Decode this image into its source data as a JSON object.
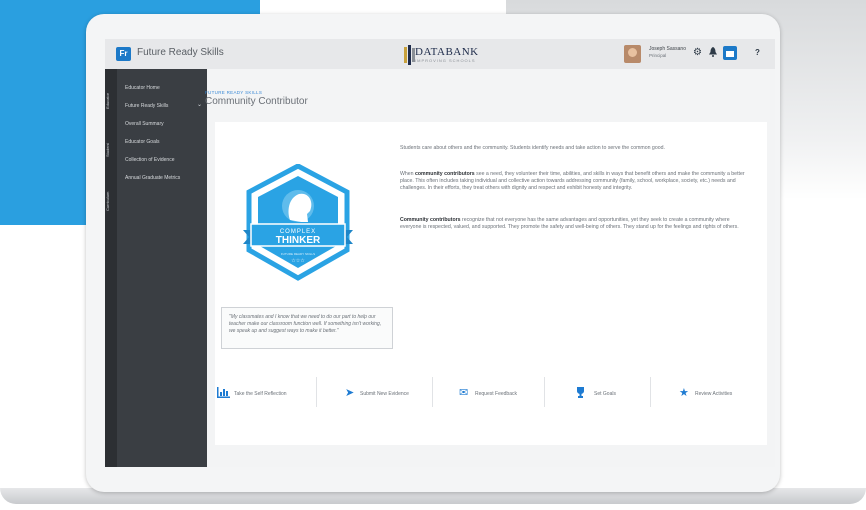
{
  "app": {
    "badge": "Fr",
    "name": "Future Ready Skills",
    "logo_text": "DATABANK",
    "logo_subtext": "IMPROVING SCHOOLS"
  },
  "user": {
    "name": "Joseph Sassano",
    "role": "Principal",
    "org": "Databank"
  },
  "toolbar": {
    "icons": [
      "gear-icon",
      "bell-icon",
      "calendar-icon",
      "help-icon"
    ],
    "glyphs": [
      "⚙",
      "🔔",
      "▣",
      "?"
    ]
  },
  "rail": {
    "tabs": [
      "Educator",
      "Student",
      "Curriculum"
    ]
  },
  "sidebar": {
    "items": [
      {
        "label": "Educator Home"
      },
      {
        "label": "Future Ready Skills"
      },
      {
        "label": "Overall Summary"
      },
      {
        "label": "Educator Goals"
      },
      {
        "label": "Collection of Evidence"
      },
      {
        "label": "Annual Graduate Metrics"
      }
    ]
  },
  "page": {
    "kicker": "FUTURE READY SKILLS",
    "title": "Community Contributor"
  },
  "badge": {
    "line1": "COMPLEX",
    "line2": "THINKER",
    "level": "FUTURE READY SKILLS",
    "stars": "☆☆☆"
  },
  "quote": {
    "text": "\"My classmates and I know that we need to do our part to help our teacher make our classroom function well. If something isn't working, we speak up and suggest ways to make it better.\""
  },
  "description": {
    "p1": "Students care about others and the community. Students identify needs and take action to serve the common good.",
    "p2_lead": "community contributors",
    "p2_pre": "When ",
    "p2_rest": " see a need, they volunteer their time, abilities, and skills in ways that benefit others and make the community a better place. This often includes taking individual and collective action towards addressing community (family, school, workplace, society, etc.) needs and challenges. In their efforts, they treat others with dignity and respect and exhibit honesty and integrity.",
    "p3_lead": "Community contributors",
    "p3_rest": " recognize that not everyone has the same advantages and opportunities, yet they seek to create a community where everyone is respected, valued, and supported. They promote the safety and well-being of others. They stand up for the feelings and rights of others."
  },
  "actions": [
    {
      "label": "Take the Self Reflection",
      "icon": "bar-chart-icon",
      "glyph": "📊"
    },
    {
      "label": "Submit New Evidence",
      "icon": "paper-plane-icon",
      "glyph": "➤"
    },
    {
      "label": "Request Feedback",
      "icon": "envelope-icon",
      "glyph": "✉"
    },
    {
      "label": "Set Goals",
      "icon": "trophy-icon",
      "glyph": "🏆"
    },
    {
      "label": "Review Activities",
      "icon": "star-icon",
      "glyph": "★"
    }
  ],
  "colors": {
    "accent": "#1e7bd2",
    "badge": "#2aa3e4",
    "sidebar": "#3a3e43"
  }
}
